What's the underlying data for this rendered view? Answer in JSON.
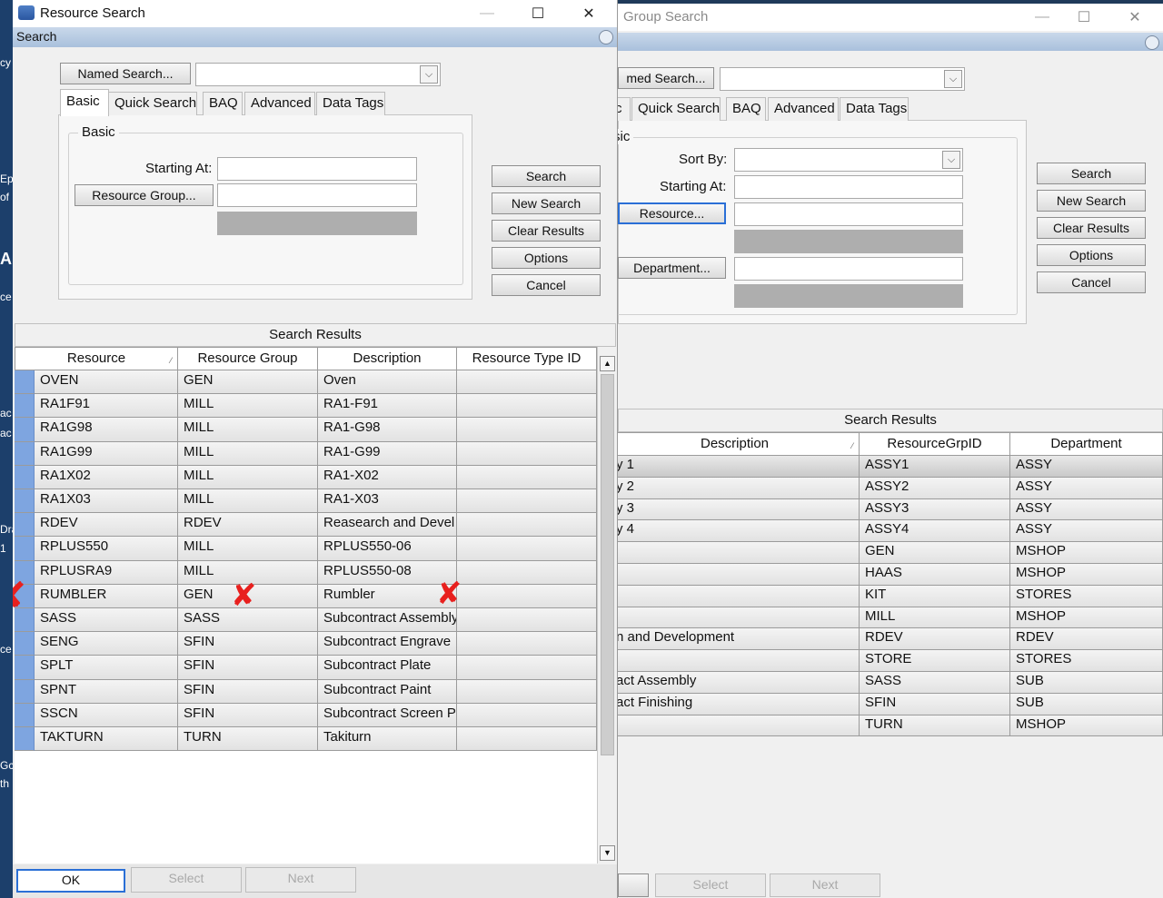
{
  "desktop": {
    "fragments": [
      "cy",
      "Ep",
      "of",
      "A",
      "ce",
      "ac",
      "ac",
      "Dra",
      "1",
      "Gc",
      "th",
      "ce"
    ]
  },
  "resource_search": {
    "title": "Resource Search",
    "menu_label": "Search",
    "named_search_label": "Named Search...",
    "tabs": [
      "Basic",
      "Quick Search",
      "BAQ",
      "Advanced",
      "Data Tags"
    ],
    "group_label": "Basic",
    "starting_at_label": "Starting At:",
    "resource_group_button": "Resource Group...",
    "actions": [
      "Search",
      "New Search",
      "Clear Results",
      "Options",
      "Cancel"
    ],
    "results_caption": "Search Results",
    "columns": [
      "Resource",
      "Resource Group",
      "Description",
      "Resource Type ID"
    ],
    "rows": [
      [
        "OVEN",
        "GEN",
        "Oven",
        ""
      ],
      [
        "RA1F91",
        "MILL",
        "RA1-F91",
        ""
      ],
      [
        "RA1G98",
        "MILL",
        "RA1-G98",
        ""
      ],
      [
        "RA1G99",
        "MILL",
        "RA1-G99",
        ""
      ],
      [
        "RA1X02",
        "MILL",
        "RA1-X02",
        ""
      ],
      [
        "RA1X03",
        "MILL",
        "RA1-X03",
        ""
      ],
      [
        "RDEV",
        "RDEV",
        "Reasearch and Devel",
        ""
      ],
      [
        "RPLUS550",
        "MILL",
        "RPLUS550-06",
        ""
      ],
      [
        "RPLUSRA9",
        "MILL",
        "RPLUS550-08",
        ""
      ],
      [
        "RUMBLER",
        "GEN",
        "Rumbler",
        ""
      ],
      [
        "SASS",
        "SASS",
        "Subcontract Assembly",
        ""
      ],
      [
        "SENG",
        "SFIN",
        "Subcontract Engrave",
        ""
      ],
      [
        "SPLT",
        "SFIN",
        "Subcontract Plate",
        ""
      ],
      [
        "SPNT",
        "SFIN",
        "Subcontract Paint",
        ""
      ],
      [
        "SSCN",
        "SFIN",
        "Subcontract Screen Pr",
        ""
      ],
      [
        "TAKTURN",
        "TURN",
        "Takiturn",
        ""
      ]
    ],
    "footer": {
      "ok": "OK",
      "select": "Select",
      "next": "Next"
    }
  },
  "group_search": {
    "title": "Group Search",
    "named_search_label": "med Search...",
    "tabs": [
      "c",
      "Quick Search",
      "BAQ",
      "Advanced",
      "Data Tags"
    ],
    "group_label": "sic",
    "sort_by_label": "Sort By:",
    "starting_at_label": "Starting At:",
    "resource_button": "Resource...",
    "department_button": "Department...",
    "actions": [
      "Search",
      "New Search",
      "Clear Results",
      "Options",
      "Cancel"
    ],
    "results_caption": "Search Results",
    "columns": [
      "Description",
      "ResourceGrpID",
      "Department"
    ],
    "rows": [
      [
        "y 1",
        "ASSY1",
        "ASSY"
      ],
      [
        "y 2",
        "ASSY2",
        "ASSY"
      ],
      [
        "y 3",
        "ASSY3",
        "ASSY"
      ],
      [
        "y 4",
        "ASSY4",
        "ASSY"
      ],
      [
        "",
        "GEN",
        "MSHOP"
      ],
      [
        "",
        "HAAS",
        "MSHOP"
      ],
      [
        "",
        "KIT",
        "STORES"
      ],
      [
        "",
        "MILL",
        "MSHOP"
      ],
      [
        "n and Development",
        "RDEV",
        "RDEV"
      ],
      [
        "",
        "STORE",
        "STORES"
      ],
      [
        "act Assembly",
        "SASS",
        "SUB"
      ],
      [
        "act Finishing",
        "SFIN",
        "SUB"
      ],
      [
        "",
        "TURN",
        "MSHOP"
      ]
    ],
    "footer": {
      "select": "Select",
      "next": "Next"
    }
  },
  "annotation": {
    "mark": "✘",
    "color": "#e8201e"
  }
}
